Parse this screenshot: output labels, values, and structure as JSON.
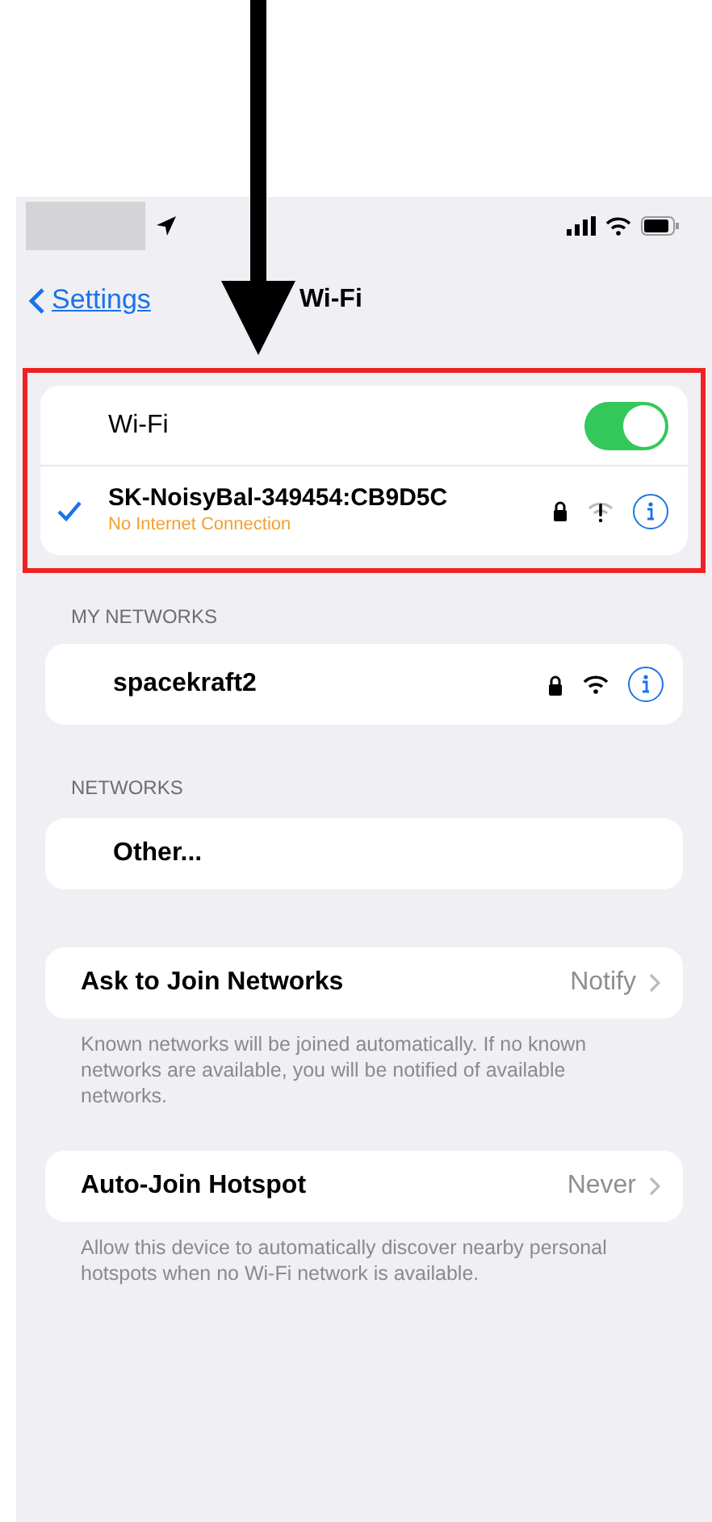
{
  "status_bar": {
    "redacted": true
  },
  "nav": {
    "back": "Settings",
    "title": "Wi-Fi"
  },
  "wifi": {
    "label": "Wi-Fi",
    "on": true,
    "highlighted": true
  },
  "current_network": {
    "name": "SK-NoisyBal-349454:CB9D5C",
    "status": "No Internet Connection",
    "checked": true,
    "secured": true,
    "kind": "warning"
  },
  "my_networks": {
    "header": "MY NETWORKS",
    "items": [
      {
        "name": "spacekraft2",
        "secured": true,
        "kind": "normal"
      }
    ]
  },
  "networks": {
    "header": "NETWORKS",
    "items": [
      {
        "name": "Other..."
      }
    ]
  },
  "settings": [
    {
      "label": "Ask to Join Networks",
      "value": "Notify",
      "footer": "Known networks will be joined automatically. If no known networks are available, you will be notified of available networks."
    },
    {
      "label": "Auto-Join Hotspot",
      "value": "Never",
      "footer": "Allow this device to automatically discover nearby personal hotspots when no Wi-Fi network is available."
    }
  ]
}
